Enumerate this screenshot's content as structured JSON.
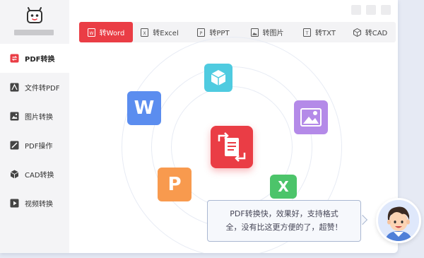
{
  "sidebar": {
    "items": [
      {
        "label": "PDF转换",
        "icon": "pdf-convert-icon"
      },
      {
        "label": "文件转PDF",
        "icon": "file-to-pdf-icon"
      },
      {
        "label": "图片转换",
        "icon": "image-convert-icon"
      },
      {
        "label": "PDF操作",
        "icon": "pdf-edit-icon"
      },
      {
        "label": "CAD转换",
        "icon": "cad-cube-icon"
      },
      {
        "label": "视频转换",
        "icon": "video-play-icon"
      }
    ]
  },
  "tabs": [
    {
      "label": "转Word",
      "icon": "word-file-icon"
    },
    {
      "label": "转Excel",
      "icon": "excel-file-icon"
    },
    {
      "label": "转PPT",
      "icon": "ppt-file-icon"
    },
    {
      "label": "转图片",
      "icon": "image-file-icon"
    },
    {
      "label": "转TXT",
      "icon": "txt-file-icon"
    },
    {
      "label": "转CAD",
      "icon": "cad-cube-icon"
    }
  ],
  "apps": {
    "word": {
      "letter": "W",
      "color": "#5b8def"
    },
    "powerpoint": {
      "letter": "P",
      "color": "#f89a4e"
    },
    "excel": {
      "letter": "X",
      "color": "#4cc46a"
    },
    "image": {
      "color": "#b48ae8"
    },
    "cube": {
      "color": "#4fcbe0"
    }
  },
  "accent_color": "#ea3d45",
  "bubble": {
    "line1": "PDF转换快，效果好，支持格式",
    "line2": "全，没有比这更方便的了，超赞！"
  }
}
